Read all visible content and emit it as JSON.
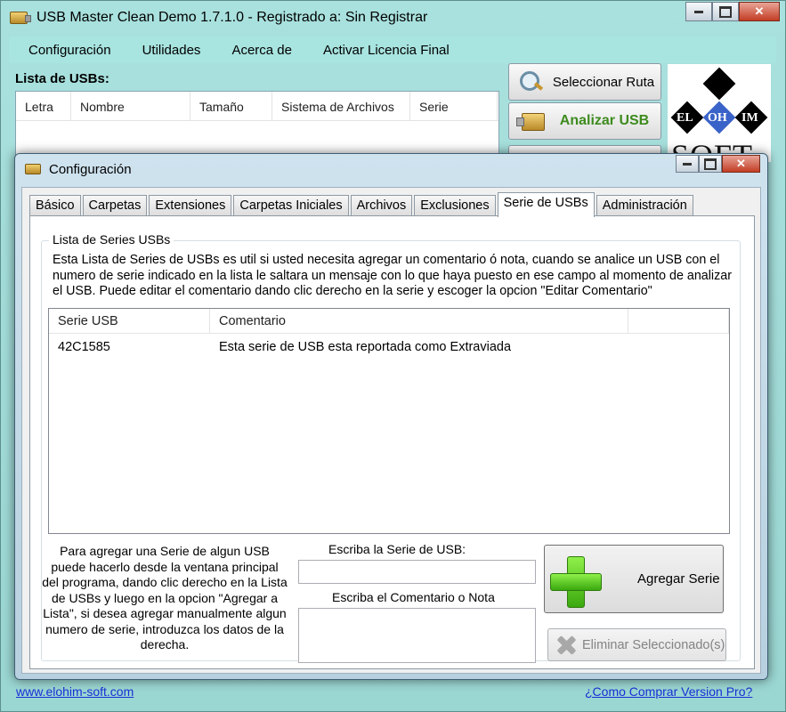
{
  "main": {
    "title": "USB Master Clean Demo 1.7.1.0 - Registrado a: Sin Registrar",
    "menu": [
      "Configuración",
      "Utilidades",
      "Acerca de",
      "Activar Licencia Final"
    ],
    "list_label": "Lista de USBs:",
    "columns": [
      "Letra",
      "Nombre",
      "Tamaño",
      "Sistema de Archivos",
      "Serie"
    ],
    "buttons": {
      "seleccionar_ruta": "Seleccionar Ruta",
      "analizar_usb": "Analizar USB"
    },
    "logo": {
      "letters": [
        "EL",
        "OH",
        "IM"
      ],
      "wordmark": "SOFT"
    },
    "footer_left": "www.elohim-soft.com",
    "footer_right": "¿Como Comprar Version Pro?"
  },
  "dialog": {
    "title": "Configuración",
    "tabs": [
      "Básico",
      "Carpetas",
      "Extensiones",
      "Carpetas Iniciales",
      "Archivos",
      "Exclusiones",
      "Serie de USBs",
      "Administración"
    ],
    "active_tab": "Serie de USBs",
    "group_title": "Lista de Series USBs",
    "description": "Esta Lista de Series de USBs es util si usted necesita agregar un comentario ó nota, cuando se analice un USB con el numero de serie indicado en la lista le saltara un mensaje con lo que haya puesto en ese campo al momento de analizar el USB. Puede editar el comentario dando clic derecho en la serie y escoger la opcion \"Editar Comentario\"",
    "list": {
      "columns": [
        "Serie USB",
        "Comentario"
      ],
      "rows": [
        {
          "serie": "42C1585",
          "comentario": "Esta serie de USB esta reportada como Extraviada"
        }
      ]
    },
    "help_text": "Para agregar una Serie de algun USB puede hacerlo desde la ventana principal del programa, dando clic derecho en la Lista de USBs y luego en la opcion \"Agregar a Lista\", si desea agregar manualmente algun numero de serie, introduzca los datos de la derecha.",
    "serie_label": "Escriba la Serie de USB:",
    "serie_value": "",
    "comment_label": "Escriba el Comentario o Nota",
    "comment_value": "",
    "add_button": "Agregar Serie",
    "delete_button": "Eliminar Seleccionado(s)"
  }
}
